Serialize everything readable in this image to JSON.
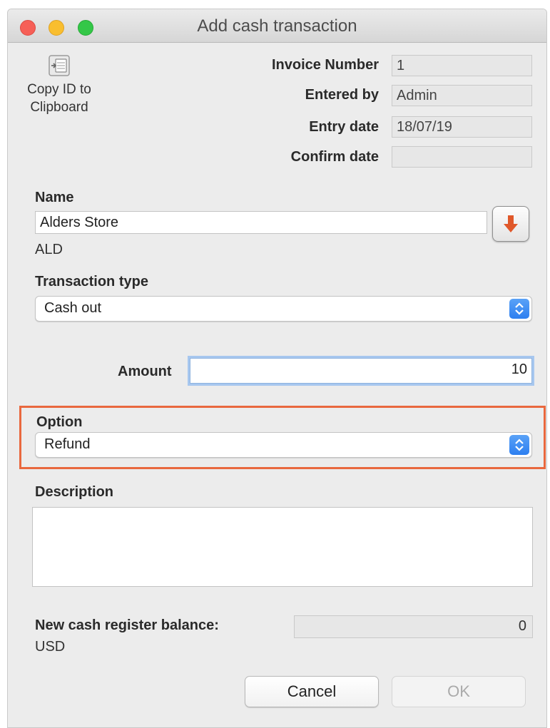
{
  "window": {
    "title": "Add cash transaction"
  },
  "copy_button": {
    "label_line1": "Copy ID to",
    "label_line2": "Clipboard",
    "icon": "copy-clipboard-icon"
  },
  "meta": {
    "invoice_number_label": "Invoice Number",
    "invoice_number_value": "1",
    "entered_by_label": "Entered by",
    "entered_by_value": "Admin",
    "entry_date_label": "Entry date",
    "entry_date_value": "18/07/19",
    "confirm_date_label": "Confirm date",
    "confirm_date_value": ""
  },
  "name": {
    "label": "Name",
    "value": "Alders Store",
    "code": "ALD",
    "lookup_icon": "down-arrow-icon"
  },
  "transaction_type": {
    "label": "Transaction type",
    "value": "Cash out"
  },
  "amount": {
    "label": "Amount",
    "value": "10"
  },
  "option": {
    "label": "Option",
    "value": "Refund",
    "highlight_color": "#e9683e"
  },
  "description": {
    "label": "Description",
    "value": ""
  },
  "balance": {
    "label": "New cash register balance:",
    "value": "0",
    "currency": "USD"
  },
  "buttons": {
    "cancel": "Cancel",
    "ok": "OK"
  },
  "colors": {
    "accent": "#2d7ff0",
    "lookup_arrow": "#e0582a"
  }
}
